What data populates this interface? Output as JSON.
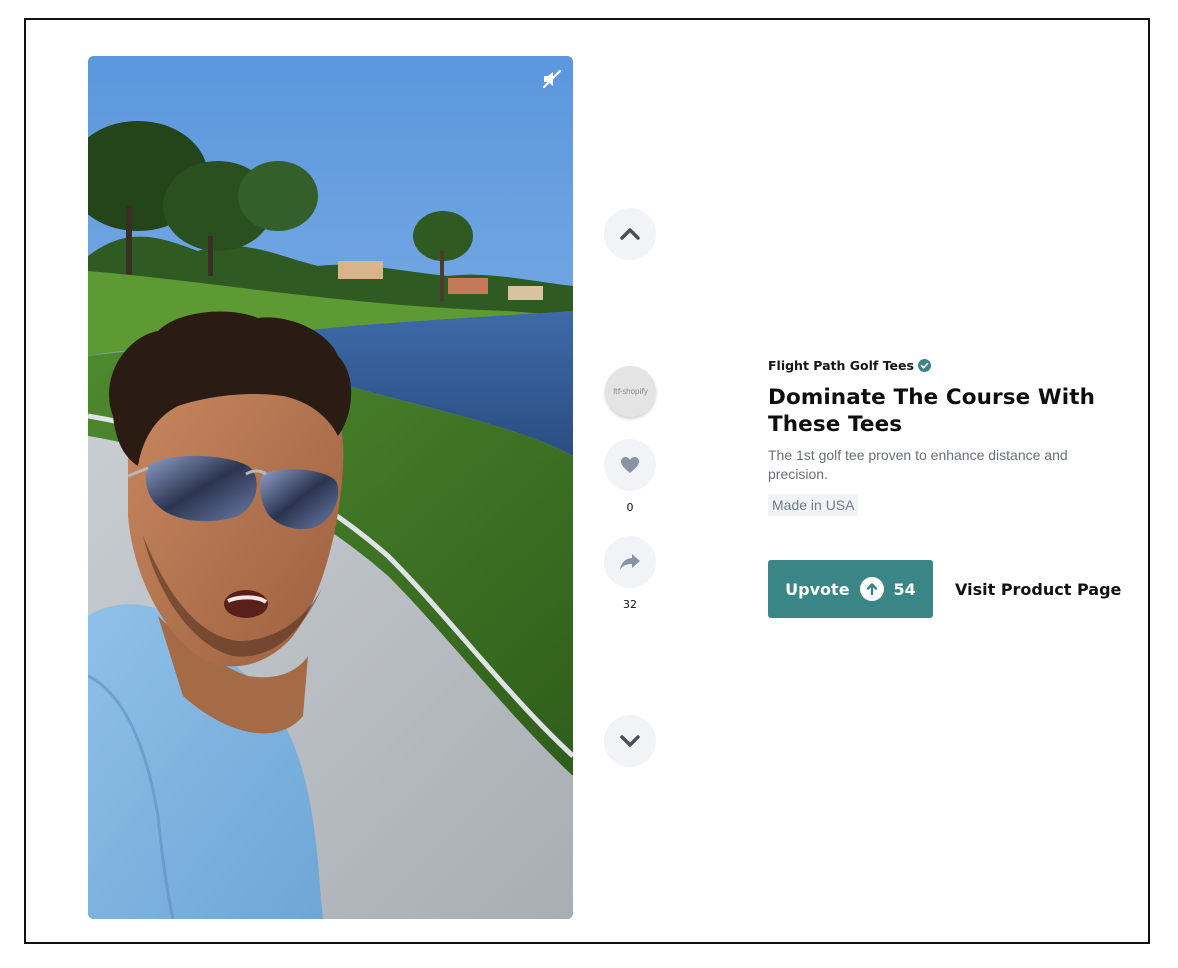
{
  "video": {
    "mute_icon": "speaker-muted-icon"
  },
  "rail": {
    "prev_icon": "chevron-up-icon",
    "next_icon": "chevron-down-icon",
    "avatar_label": "ltf-shopify",
    "like_icon": "heart-icon",
    "like_count": "0",
    "share_icon": "share-arrow-icon",
    "share_count": "32"
  },
  "product": {
    "brand": "Flight Path Golf Tees",
    "verified_icon": "verified-badge-icon",
    "title": "Dominate The Course With These Tees",
    "description": "The 1st golf tee proven to enhance distance and precision.",
    "tag": "Made in USA"
  },
  "actions": {
    "upvote_label": "Upvote",
    "upvote_icon": "arrow-up-circle-icon",
    "upvote_count": "54",
    "visit_label": "Visit Product Page"
  },
  "colors": {
    "accent": "#3a8585",
    "rail_button_bg": "#f2f3f7",
    "rail_icon": "#8a93a6",
    "tag_bg": "#f2f3f6"
  }
}
